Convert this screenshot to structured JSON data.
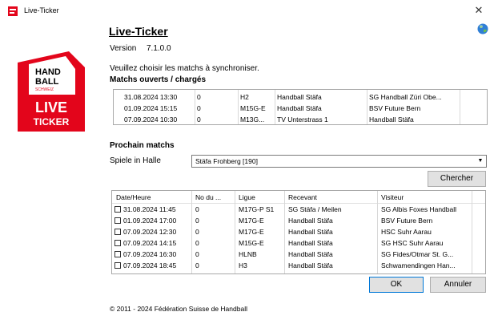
{
  "window": {
    "title": "Live-Ticker",
    "close_glyph": "✕"
  },
  "logo": {
    "line1": "HAND",
    "line2": "BALL",
    "line3": "SCHWEIZ",
    "line4": "LIVE",
    "line5": "TICKER",
    "red": "#e3051b"
  },
  "header": {
    "title": "Live-Ticker",
    "version_label": "Version",
    "version_value": "7.1.0.0"
  },
  "instruction": "Veuillez choisir les matchs à synchroniser.",
  "open_matches": {
    "heading": "Matchs ouverts / chargés",
    "rows": [
      [
        "31.08.2024 13:30",
        "0",
        "H2",
        "Handball Stäfa",
        "SG Handball Züri Obe..."
      ],
      [
        "01.09.2024 15:15",
        "0",
        "M15G-E",
        "Handball Stäfa",
        "BSV Future Bern"
      ],
      [
        "07.09.2024 10:30",
        "0",
        "M13G...",
        "TV Unterstrass 1",
        "Handball Stäfa"
      ]
    ]
  },
  "next_matches": {
    "heading": "Prochain matchs",
    "halle_label": "Spiele in Halle",
    "halle_value": "Stäfa Frohberg [190]",
    "search_button": "Chercher",
    "columns": [
      "Date/Heure",
      "No du ...",
      "Ligue",
      "Recevant",
      "Visiteur"
    ],
    "rows": [
      [
        "31.08.2024 11:45",
        "0",
        "M17G-P S1",
        "SG Stäfa / Meilen",
        "SG Albis Foxes Handball"
      ],
      [
        "01.09.2024 17:00",
        "0",
        "M17G-E",
        "Handball Stäfa",
        "BSV Future Bern"
      ],
      [
        "07.09.2024 12:30",
        "0",
        "M17G-E",
        "Handball Stäfa",
        "HSC Suhr Aarau"
      ],
      [
        "07.09.2024 14:15",
        "0",
        "M15G-E",
        "Handball Stäfa",
        "SG HSC Suhr Aarau"
      ],
      [
        "07.09.2024 16:30",
        "0",
        "HLNB",
        "Handball Stäfa",
        "SG Fides/Otmar St. G..."
      ],
      [
        "07.09.2024 18:45",
        "0",
        "H3",
        "Handball Stäfa",
        "Schwamendingen Han..."
      ]
    ]
  },
  "buttons": {
    "ok": "OK",
    "cancel": "Annuler"
  },
  "footer": {
    "copyright": "© 2011 - 2024 Fédération Suisse de Handball"
  }
}
